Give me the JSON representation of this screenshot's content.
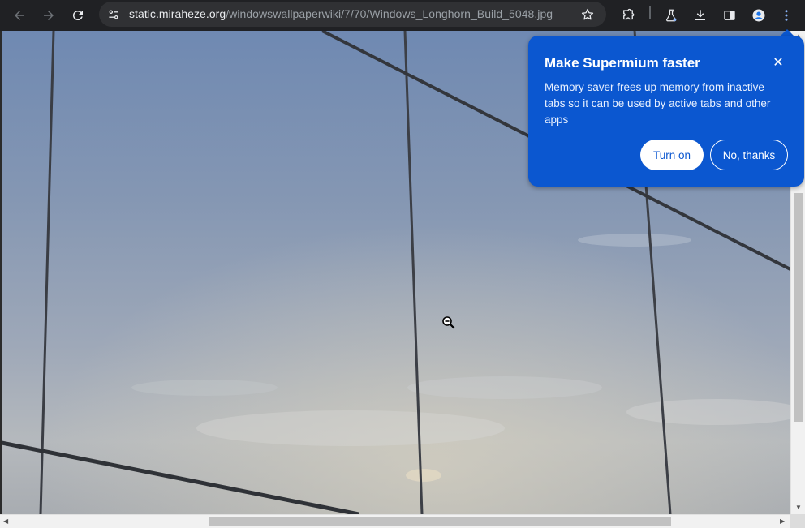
{
  "toolbar": {
    "url_domain": "static.miraheze.org",
    "url_path": "/windowswallpaperwiki/7/70/Windows_Longhorn_Build_5048.jpg",
    "icons": [
      "back-arrow-icon",
      "forward-arrow-icon",
      "reload-icon",
      "site-info-icon",
      "bookmark-star-icon",
      "extensions-icon",
      "labs-flask-icon",
      "download-icon",
      "side-panel-icon",
      "profile-avatar-icon",
      "more-menu-icon"
    ]
  },
  "popup": {
    "title": "Make Supermium faster",
    "body": "Memory saver frees up memory from inactive tabs so it can be used by active tabs and other apps",
    "turn_on_label": "Turn on",
    "no_thanks_label": "No, thanks",
    "accent": "#0b57d0"
  },
  "content": {
    "image": "sky-with-cables-photo",
    "cursor": "zoom-out-cursor-icon"
  },
  "colors": {
    "toolbar_bg": "#202124",
    "omnibox_bg": "#303134",
    "popup_bg": "#0b57d0"
  }
}
